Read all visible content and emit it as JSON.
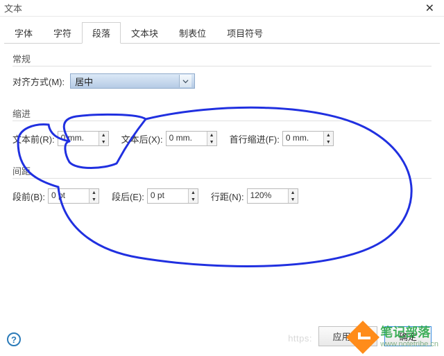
{
  "window": {
    "title": "文本"
  },
  "tabs": {
    "items": [
      "字体",
      "字符",
      "段落",
      "文本块",
      "制表位",
      "项目符号"
    ],
    "active": "段落"
  },
  "groups": {
    "general": {
      "title": "常规",
      "align_label": "对齐方式(M):",
      "align_value": "居中"
    },
    "indent": {
      "title": "缩进",
      "before_label": "文本前(R):",
      "before_value": "0 mm.",
      "after_label": "文本后(X):",
      "after_value": "0 mm.",
      "first_label": "首行缩进(F):",
      "first_value": "0 mm."
    },
    "spacing": {
      "title": "间距",
      "before_label": "段前(B):",
      "before_value": "0 pt",
      "after_label": "段后(E):",
      "after_value": "0 pt",
      "line_label": "行距(N):",
      "line_value": "120%"
    }
  },
  "buttons": {
    "apply": "应用(A)",
    "ok": "确定"
  },
  "help": "?",
  "watermark": {
    "cn": "笔记部落",
    "en": "www.notetribe.cn",
    "faint": "https:"
  }
}
